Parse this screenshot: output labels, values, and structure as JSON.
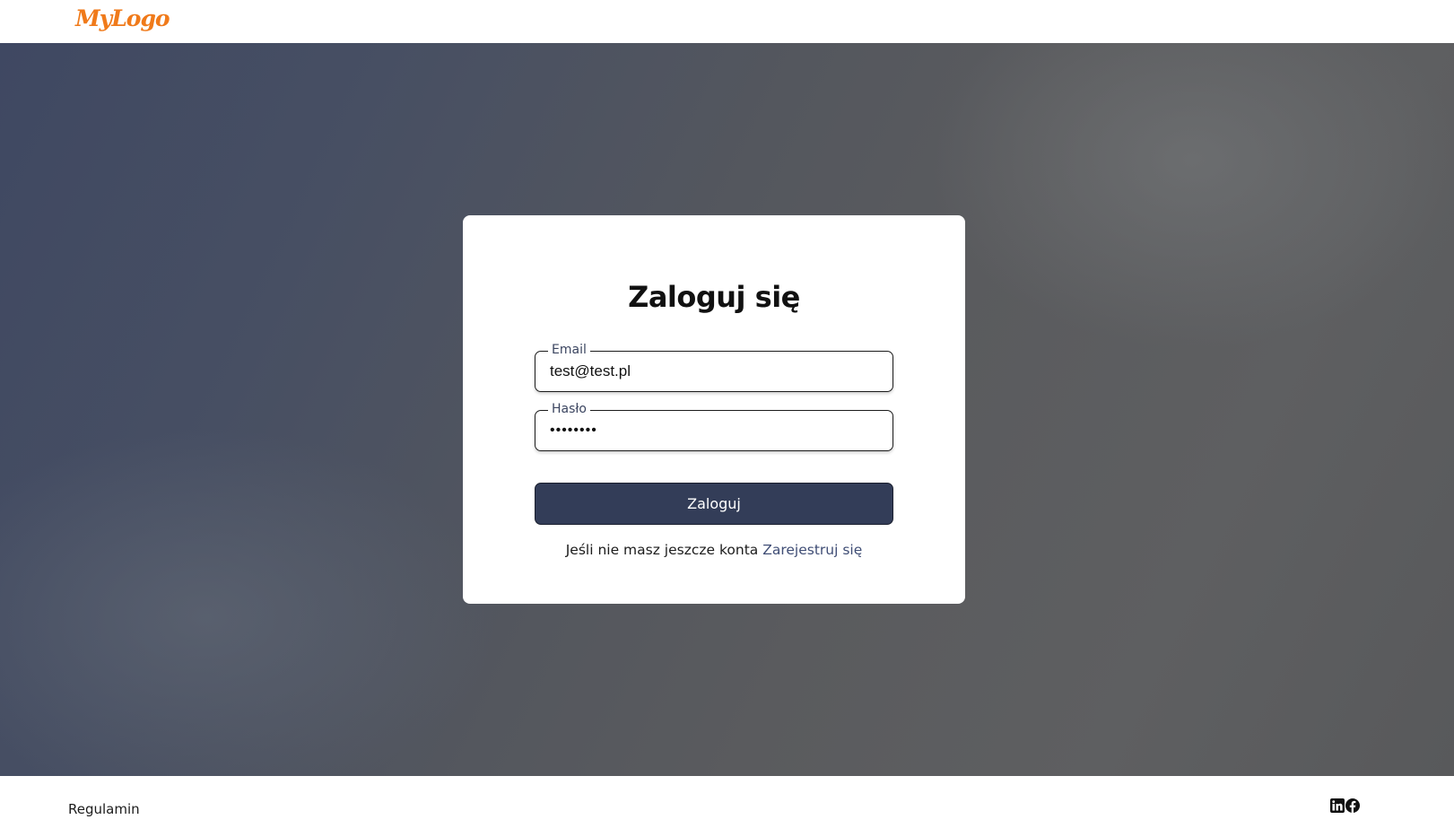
{
  "header": {
    "logo_text": "MyLogo",
    "logo_color": "#f07a1a"
  },
  "login": {
    "title": "Zaloguj się",
    "email_label": "Email",
    "email_value": "test@test.pl",
    "password_label": "Hasło",
    "password_value": "••••••••",
    "submit_label": "Zaloguj",
    "register_prompt": "Jeśli nie masz jeszcze konta",
    "register_link": "Zarejestruj się"
  },
  "footer": {
    "terms_link": "Regulamin",
    "social_icons": [
      "linkedin-icon",
      "facebook-icon"
    ]
  },
  "colors": {
    "button": "#333d58",
    "link": "#3f4d75",
    "label": "#3b4560"
  }
}
